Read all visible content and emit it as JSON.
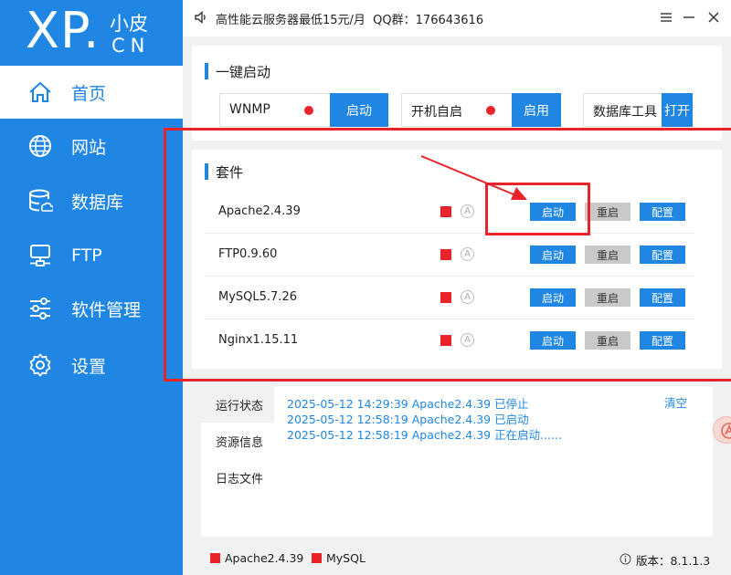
{
  "brand": {
    "logo_main": "XP.",
    "logo_small": "小皮",
    "logo_cn": "CN"
  },
  "sidebar": {
    "items": [
      {
        "label": "首页",
        "icon": "home-icon",
        "active": true
      },
      {
        "label": "网站",
        "icon": "globe-icon"
      },
      {
        "label": "数据库",
        "icon": "database-icon"
      },
      {
        "label": "FTP",
        "icon": "ftp-server-icon"
      },
      {
        "label": "软件管理",
        "icon": "sliders-icon"
      },
      {
        "label": "设置",
        "icon": "gear-icon"
      }
    ]
  },
  "topbar": {
    "notice": "高性能云服务器最低15元/月  QQ群：176643616"
  },
  "quickstart": {
    "title": "一键启动",
    "items": [
      {
        "label": "WNMP",
        "button": "启动"
      },
      {
        "label": "开机自启",
        "button": "启用"
      },
      {
        "label": "数据库工具",
        "button": "打开"
      }
    ]
  },
  "suite": {
    "title": "套件",
    "auto_glyph": "A",
    "rows": [
      {
        "name": "Apache2.4.39",
        "start": "启动",
        "restart": "重启",
        "config": "配置"
      },
      {
        "name": "FTP0.9.60",
        "start": "启动",
        "restart": "重启",
        "config": "配置"
      },
      {
        "name": "MySQL5.7.26",
        "start": "启动",
        "restart": "重启",
        "config": "配置"
      },
      {
        "name": "Nginx1.15.11",
        "start": "启动",
        "restart": "重启",
        "config": "配置"
      }
    ]
  },
  "log": {
    "tabs": [
      "运行状态",
      "资源信息",
      "日志文件"
    ],
    "clear": "清空",
    "lines": [
      "2025-05-12 14:29:39 Apache2.4.39 已停止",
      "2025-05-12 12:58:19 Apache2.4.39 已启动",
      "2025-05-12 12:58:19 Apache2.4.39 正在启动......"
    ]
  },
  "statusbar": {
    "services": [
      "Apache2.4.39",
      "MySQL"
    ],
    "version": "版本：8.1.1.3"
  },
  "colors": {
    "accent": "#1f87e3",
    "status_stopped": "#e8232a",
    "annotation": "#e8232a"
  }
}
